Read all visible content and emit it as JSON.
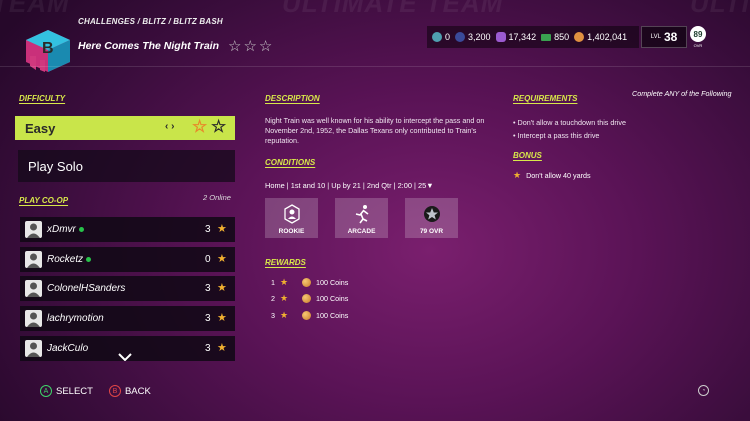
{
  "header": {
    "breadcrumb": "CHALLENGES / BLITZ / BLITZ BASH",
    "title": "Here Comes The Night Train",
    "title_stars": "☆☆☆",
    "bg_text_left": "TEAM",
    "bg_text_right": "ULTIMATE TEAM",
    "bg_text_far": "ULTIMA"
  },
  "currency": {
    "items": [
      {
        "icon": "training-icon",
        "value": "0",
        "color": "#4fa0b0"
      },
      {
        "icon": "points-icon",
        "value": "3,200",
        "color": "#3a4a9a"
      },
      {
        "icon": "mut-credits-icon",
        "value": "17,342",
        "color": "#9b5ad0"
      },
      {
        "icon": "cash-icon",
        "value": "850",
        "color": "#3aa050"
      },
      {
        "icon": "coins-icon",
        "value": "1,402,041",
        "color": "#e09040"
      }
    ],
    "level_label": "LVL",
    "level": "38",
    "ovr": "89",
    "ovr_label": "OVR"
  },
  "left": {
    "difficulty_heading": "DIFFICULTY",
    "difficulty_value": "Easy",
    "difficulty_arrows": "‹ ›",
    "play_solo": "Play Solo",
    "coop_heading": "PLAY CO-OP",
    "online_count": "2 Online",
    "players": [
      {
        "name": "xDmvr",
        "online": true,
        "stars": "3"
      },
      {
        "name": "Rocketz",
        "online": true,
        "stars": "0"
      },
      {
        "name": "ColonelHSanders",
        "online": false,
        "stars": "3"
      },
      {
        "name": "lachrymotion",
        "online": false,
        "stars": "3"
      },
      {
        "name": "JackCulo",
        "online": false,
        "stars": "3"
      }
    ]
  },
  "middle": {
    "description_heading": "DESCRIPTION",
    "description": "Night Train was well known for his ability to intercept the pass and on November 2nd, 1952, the Dallas Texans only contributed to Train's reputation.",
    "conditions_heading": "CONDITIONS",
    "conditions_text": "Home | 1st and 10 | Up by 21 | 2nd Qtr | 2:00 | 25▼",
    "condition_cards": [
      {
        "label": "ROOKIE",
        "icon": "rookie-icon"
      },
      {
        "label": "ARCADE",
        "icon": "arcade-icon"
      },
      {
        "label": "79 OVR",
        "icon": "ovr-star-icon"
      }
    ],
    "rewards_heading": "REWARDS",
    "rewards": [
      {
        "rank": "1",
        "amount": "100 Coins"
      },
      {
        "rank": "2",
        "amount": "100 Coins"
      },
      {
        "rank": "3",
        "amount": "100 Coins"
      }
    ]
  },
  "right": {
    "requirements_heading": "REQUIREMENTS",
    "complete_any": "Complete ANY of the Following",
    "requirements": [
      "• Don't allow a touchdown this drive",
      "• Intercept a pass this drive"
    ],
    "bonus_heading": "BONUS",
    "bonus": "Don't allow 40 yards"
  },
  "footer": {
    "select_button": "A",
    "select_label": "SELECT",
    "back_button": "B",
    "back_label": "BACK"
  },
  "colors": {
    "accent": "#c9e54a",
    "star": "#f0b030",
    "online_dot": "#27c24a"
  }
}
